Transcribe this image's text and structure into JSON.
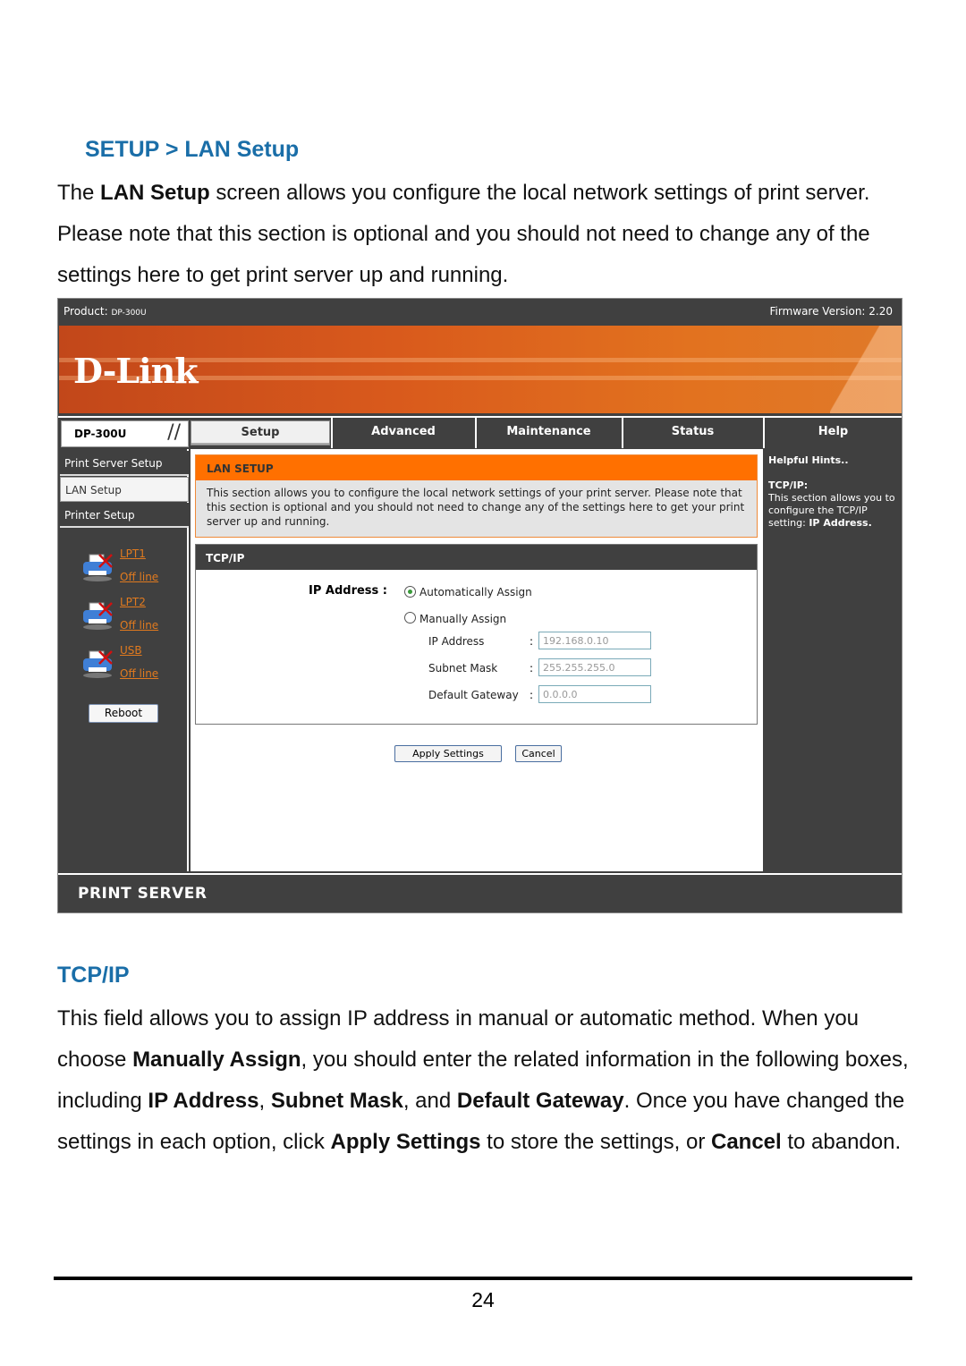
{
  "doc": {
    "section_heading": "SETUP > LAN Setup",
    "intro": {
      "before": "The ",
      "bold": "LAN Setup",
      "after": " screen allows you configure the local network settings of print server. Please note that this section is optional and you should not need to change any of the settings here to get print server up and running."
    },
    "tcp_heading": "TCP/IP",
    "tcp_para": {
      "t1": "This field allows you to assign IP address in manual or automatic method. When you choose ",
      "b1": "Manually Assign",
      "t2": ", you should enter the related information in the following boxes, including ",
      "b2": "IP Address",
      "t3": ", ",
      "b3": "Subnet Mask",
      "t4": ", and ",
      "b4": "Default Gateway",
      "t5": ". Once you have changed the settings in each option, click ",
      "b5": "Apply Settings",
      "t6": " to store the settings, or ",
      "b6": "Cancel",
      "t7": " to abandon."
    },
    "page_number": "24"
  },
  "ui": {
    "product_label": "Product:",
    "product_value": "DP-300U",
    "firmware": "Firmware Version: 2.20",
    "brand": "D-Link",
    "model": "DP-300U",
    "tabs": [
      {
        "label": "Setup",
        "active": true
      },
      {
        "label": "Advanced"
      },
      {
        "label": "Maintenance"
      },
      {
        "label": "Status"
      },
      {
        "label": "Help"
      }
    ],
    "left_nav": [
      {
        "label": "Print Server Setup"
      },
      {
        "label": "LAN Setup",
        "active": true
      },
      {
        "label": "Printer Setup"
      }
    ],
    "ports": [
      {
        "name": "LPT1",
        "status": "Off line"
      },
      {
        "name": "LPT2",
        "status": "Off line"
      },
      {
        "name": "USB",
        "status": "Off line"
      }
    ],
    "reboot": "Reboot",
    "lan_setup": {
      "title": "LAN SETUP",
      "body": "This section allows you to configure the local network settings of your print server. Please note that this section is optional and you should not need to change any of the settings here to get your print server up and running."
    },
    "tcpip": {
      "title": "TCP/IP",
      "ip_label": "IP Address :",
      "auto_label": "Automatically Assign",
      "manual_label": "Manually Assign",
      "selected": "Automatically Assign",
      "fields": [
        {
          "label": "IP Address",
          "value": "192.168.0.10"
        },
        {
          "label": "Subnet Mask",
          "value": "255.255.255.0"
        },
        {
          "label": "Default Gateway",
          "value": "0.0.0.0"
        }
      ]
    },
    "apply": "Apply Settings",
    "cancel": "Cancel",
    "help": {
      "title": "Helpful Hints..",
      "topic": "TCP/IP:",
      "text": "This section allows you to configure the TCP/IP setting: ",
      "bold": "IP Address."
    },
    "footer": "PRINT SERVER"
  }
}
